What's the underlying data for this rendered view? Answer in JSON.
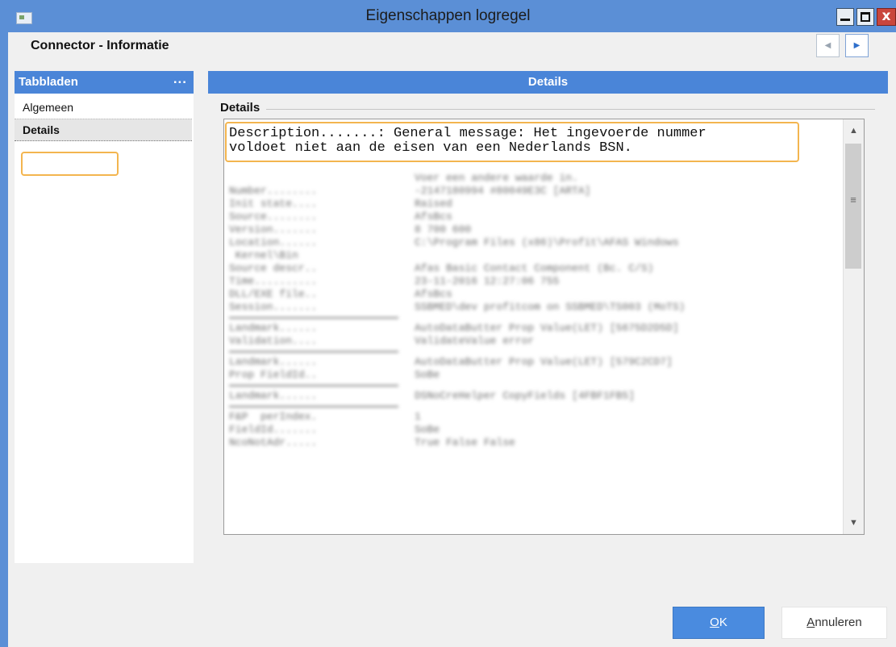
{
  "window": {
    "title": "Eigenschappen logregel",
    "close_label": "x"
  },
  "header": {
    "title": "Connector - Informatie",
    "prev_icon": "triangle-left-icon",
    "next_icon": "triangle-right-icon"
  },
  "sidebar": {
    "title": "Tabbladen",
    "menu_label": "...",
    "items": [
      {
        "label": "Algemeen",
        "selected": false
      },
      {
        "label": "Details",
        "selected": true
      }
    ]
  },
  "main": {
    "header": "Details",
    "group_title": "Details",
    "description_text": "Description.......: General message: Het ingevoerde nummer\nvoldoet niet aan de eisen van een Nederlands BSN.",
    "blurred_rows": [
      {
        "k": "",
        "v": "Voer een andere waarde in."
      },
      {
        "k": "Number........",
        "v": "-2147180994 #80049E3C [ARTA]"
      },
      {
        "k": "Init state....",
        "v": "Raised"
      },
      {
        "k": "Source........",
        "v": "AfsBcs"
      },
      {
        "k": "Version.......",
        "v": "8 700 600"
      },
      {
        "k": "Location......",
        "v": "C:\\Program Files (x86)\\Profit\\AFAS Windows"
      },
      {
        "k": " Kernel\\Bin",
        "v": ""
      },
      {
        "k": "Source descr..",
        "v": "Afas Basic Contact Component (Bc. C/S)"
      },
      {
        "k": "Time..........",
        "v": "23-11-2016 12:27:06 755"
      },
      {
        "k": "DLL/EXE file..",
        "v": "AfsBcs"
      },
      {
        "k": "Session.......",
        "v": "SSBMED\\dev profitcom on SSBMED\\TS003 (MoTS)"
      },
      {
        "k": "---",
        "v": ""
      },
      {
        "k": "Landmark......",
        "v": "AutoDataButter Prop Value(LET) [5675D2D5D]"
      },
      {
        "k": "Validation....",
        "v": "ValidateValue error"
      },
      {
        "k": "---",
        "v": ""
      },
      {
        "k": "Landmark......",
        "v": "AutoDataButter Prop Value(LET) [579C2CD7]"
      },
      {
        "k": "Prop FieldId..",
        "v": "SoBe"
      },
      {
        "k": "---",
        "v": ""
      },
      {
        "k": "Landmark......",
        "v": "DSNoCreHelper CopyFields [4FBF1FB5]"
      },
      {
        "k": "---",
        "v": ""
      },
      {
        "k": "F&P  perIndex.",
        "v": "1"
      },
      {
        "k": "FieldId.......",
        "v": "SoBe"
      },
      {
        "k": "NcoNotAdr.....",
        "v": "True False False"
      }
    ]
  },
  "buttons": {
    "ok": {
      "mnemonic": "O",
      "rest": "K"
    },
    "cancel": {
      "mnemonic": "A",
      "rest": "nnuleren"
    }
  }
}
